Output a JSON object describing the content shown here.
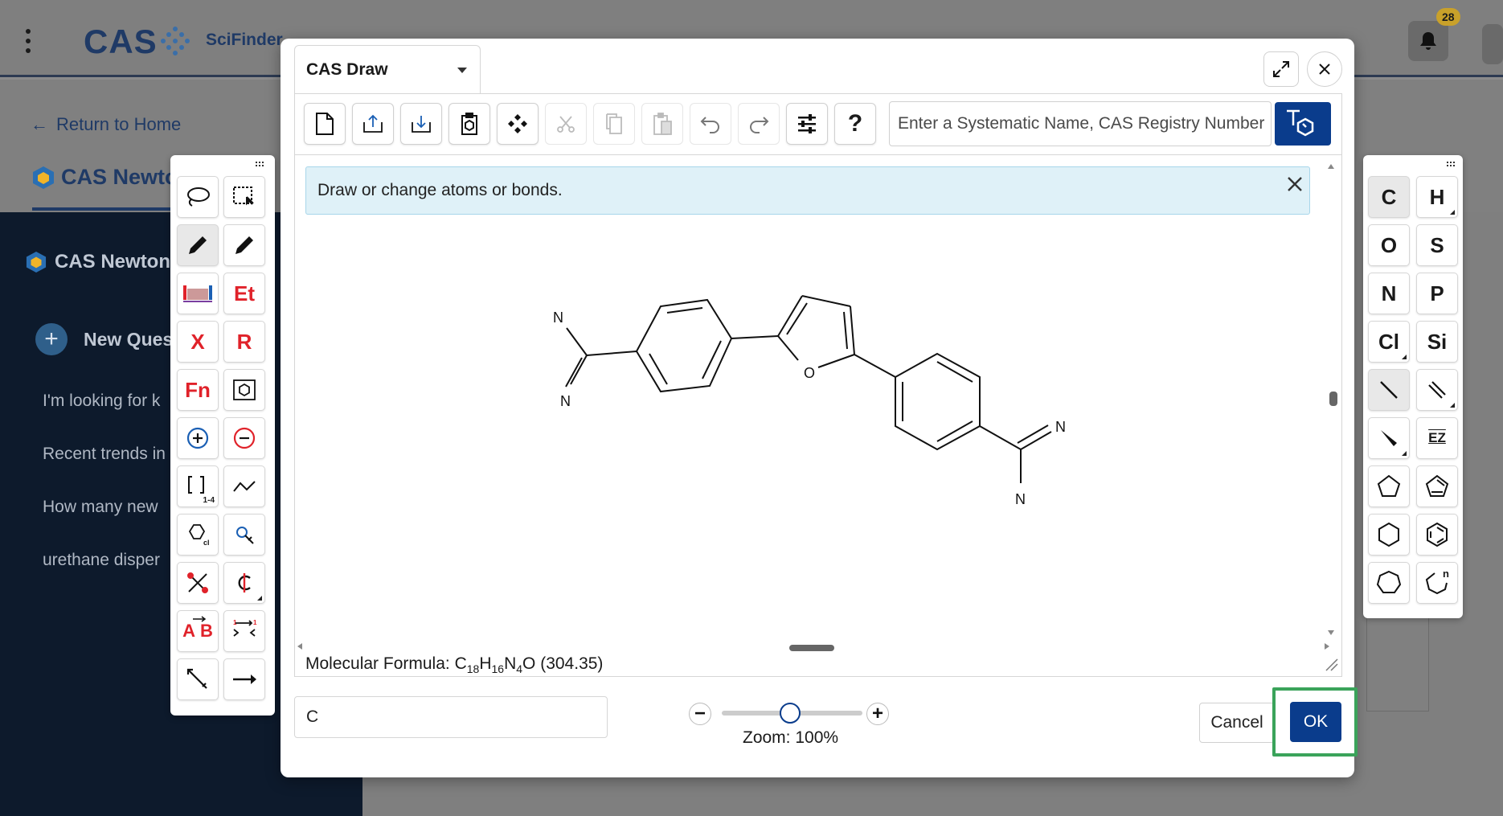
{
  "app": {
    "brand": "CAS",
    "product": "SciFinder",
    "notification_count": "28"
  },
  "nav": {
    "return_label": "Return to Home",
    "tab_label": "CAS Newto"
  },
  "sidebar": {
    "title": "CAS Newton",
    "new_question": "New Ques",
    "history": [
      "I'm looking for k",
      "Recent trends in",
      "How many new",
      "urethane disper"
    ]
  },
  "modal": {
    "title": "CAS Draw",
    "search_placeholder": "Enter a Systematic Name, CAS Registry Number",
    "hint": "Draw or change atoms or bonds.",
    "formula_label": "Molecular Formula: ",
    "formula": {
      "c": "C",
      "c_n": "18",
      "h": "H",
      "h_n": "16",
      "n": "N",
      "n_n": "4",
      "o": "O",
      "mass": " (304.35)"
    },
    "atom_value": "C",
    "zoom_label": "Zoom: 100%",
    "zoom_percent": 100,
    "cancel": "Cancel",
    "ok": "OK"
  },
  "structure": {
    "atoms": [
      "N",
      "N",
      "O",
      "N",
      "N"
    ]
  },
  "left_palette": {
    "labels": [
      "Et",
      "X",
      "R",
      "Fn",
      "1-4",
      "A",
      "B"
    ]
  },
  "right_palette": {
    "atoms": [
      "C",
      "H",
      "O",
      "S",
      "N",
      "P",
      "Cl",
      "Si"
    ],
    "ez_label": "EZ",
    "ring_n": "n"
  }
}
